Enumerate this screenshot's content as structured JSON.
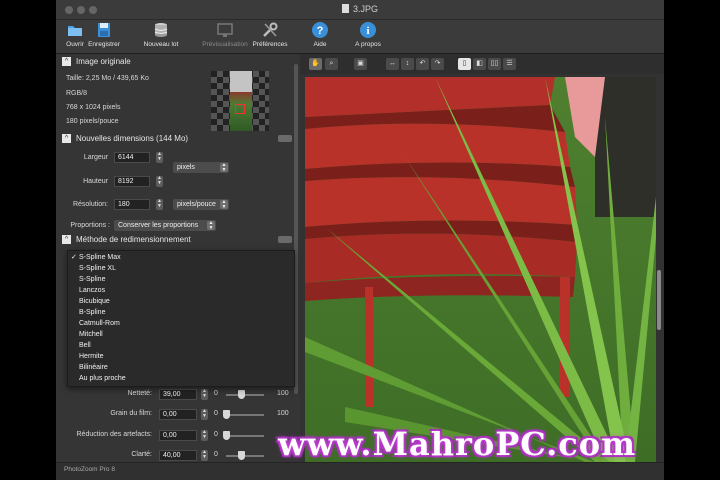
{
  "window": {
    "title": "3.JPG",
    "app_name": "PhotoZoom Pro 8"
  },
  "toolbar": {
    "open": "Ouvrir",
    "save": "Enregistrer",
    "new_batch": "Nouveau lot",
    "preview": "Prévisualisation",
    "preferences": "Préférences",
    "help": "Aide",
    "about": "A propos"
  },
  "original": {
    "header": "Image originale",
    "size": "Taille: 2,25 Mo / 439,65 Ko",
    "mode": "RGB/8",
    "dims": "768 x 1024 pixels",
    "resolution": "180 pixels/pouce"
  },
  "new_dims": {
    "header": "Nouvelles dimensions (144 Mo)",
    "width_label": "Largeur",
    "width": "6144",
    "height_label": "Hauteur",
    "height": "8192",
    "unit": "pixels",
    "res_label": "Résolution:",
    "res": "180",
    "res_unit": "pixels/pouce",
    "proportions_label": "Proportions :",
    "proportions_value": "Conserver les proportions"
  },
  "method": {
    "header": "Méthode de redimensionnement",
    "options": [
      "S-Spline Max",
      "S-Spline XL",
      "S-Spline",
      "Lanczos",
      "Bicubique",
      "B-Spline",
      "Catmull-Rom",
      "Mitchell",
      "Bell",
      "Hermite",
      "Bilinéaire",
      "Au plus proche"
    ],
    "selected_index": 0
  },
  "sliders": [
    {
      "label": "Netteté:",
      "value": "39,00",
      "min": "0",
      "max": "100",
      "level": 0.39
    },
    {
      "label": "Grain du film:",
      "value": "0,00",
      "min": "0",
      "max": "100",
      "level": 0.0
    },
    {
      "label": "Réduction des artefacts:",
      "value": "0,00",
      "min": "0",
      "max": "",
      "level": 0.0
    },
    {
      "label": "Clarté:",
      "value": "40,00",
      "min": "0",
      "max": "",
      "level": 0.4
    }
  ],
  "watermark": "www.MahroPC.com",
  "colors": {
    "panel": "#353535",
    "accent_blue": "#3a8fd9",
    "watermark_glow": "#d94fe6",
    "chair_red": "#b8322a",
    "leaf_green": "#6fae3c"
  }
}
